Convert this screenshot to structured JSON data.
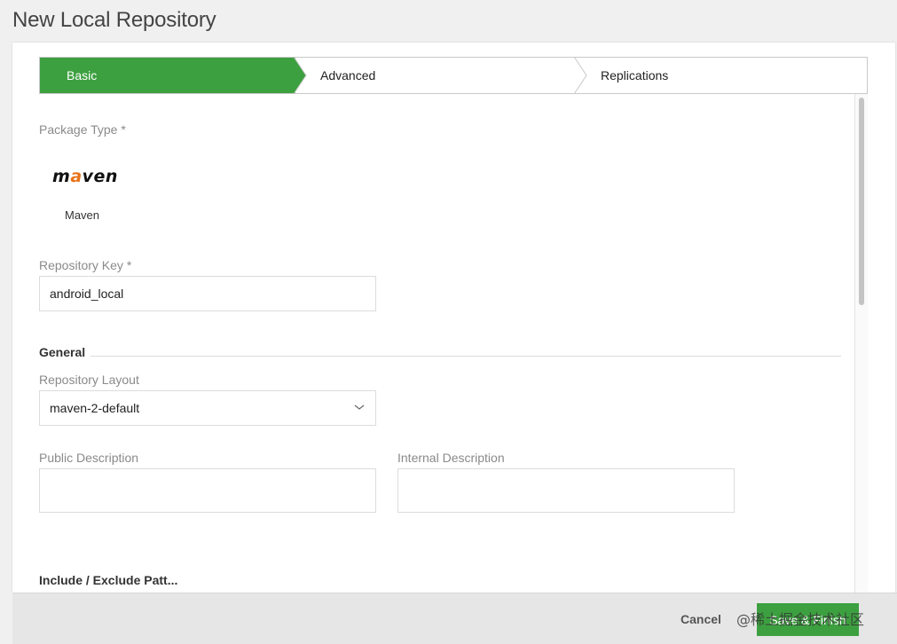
{
  "page": {
    "title": "New Local Repository"
  },
  "wizard": {
    "steps": [
      {
        "label": "Basic",
        "active": true
      },
      {
        "label": "Advanced",
        "active": false
      },
      {
        "label": "Replications",
        "active": false
      }
    ]
  },
  "basic": {
    "package_type_label": "Package Type *",
    "package_logo_text": {
      "pre": "m",
      "accent": "a",
      "post": "ven"
    },
    "package_name": "Maven",
    "repository_key_label": "Repository Key *",
    "repository_key_value": "android_local",
    "general_section_title": "General",
    "repository_layout_label": "Repository Layout",
    "repository_layout_value": "maven-2-default",
    "public_description_label": "Public Description",
    "public_description_value": "",
    "internal_description_label": "Internal Description",
    "internal_description_value": "",
    "next_section_title_partial": "Include / Exclude Patt..."
  },
  "footer": {
    "cancel_label": "Cancel",
    "save_label": "Save & Finish"
  },
  "watermark": "@稀土掘金技术社区",
  "colors": {
    "accent": "#3da040",
    "maven_accent": "#e8731b"
  }
}
